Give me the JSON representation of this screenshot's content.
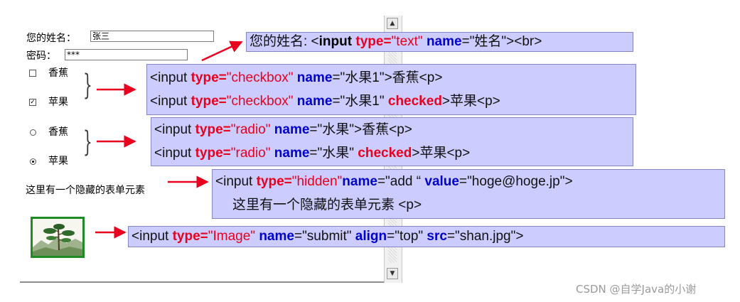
{
  "form": {
    "name_label": "您的姓名：",
    "name_value": "张三",
    "password_label": "密码：",
    "password_value": "***",
    "checkbox_items": [
      {
        "label": "香蕉",
        "checked": false
      },
      {
        "label": "苹果",
        "checked": true
      }
    ],
    "radio_items": [
      {
        "label": "香蕉",
        "checked": false
      },
      {
        "label": "苹果",
        "checked": true
      }
    ],
    "hidden_text": "这里有一个隐藏的表单元素",
    "check_mark": "✓"
  },
  "scrollbar": {
    "up_arrow": "▲",
    "down_arrow": "▼"
  },
  "annotations": {
    "text_input": {
      "t1": "您的姓名: <",
      "tag": "input",
      "attr_type": "type=",
      "val_type": "\"text\"",
      "attr_name": "name",
      "name_val": "=\"姓名\"><br>"
    },
    "checkbox": {
      "line1": {
        "open": "<input ",
        "attr_type": "type=",
        "val_type": "\"checkbox\"",
        "attr_name": " name",
        "rest": "=\"水果1\">香蕉<p>"
      },
      "line2": {
        "open": "<input ",
        "attr_type": "type=",
        "val_type": "\"checkbox\"",
        "attr_name": " name",
        "mid": "=\"水果1\" ",
        "checked": "checked",
        "rest": ">苹果<p>"
      }
    },
    "radio": {
      "line1": {
        "open": "<input ",
        "attr_type": "type=",
        "val_type": "\"radio\"",
        "attr_name": " name",
        "rest": "=\"水果\">香蕉<p>"
      },
      "line2": {
        "open": "<input ",
        "attr_type": "type=",
        "val_type": "\"radio\"",
        "attr_name": " name",
        "mid": "=\"水果\" ",
        "checked": "checked",
        "rest": ">苹果<p>"
      }
    },
    "hidden": {
      "line1": {
        "open": "<input ",
        "attr_type": "type=",
        "val_type": "\"hidden\"",
        "attr_name": "name",
        "mid": "=\"add “ ",
        "attr_value": "value",
        "rest": "=\"hoge@hoge.jp\">"
      },
      "line2": "这里有一个隐藏的表单元素 <p>"
    },
    "image": {
      "open": "<input ",
      "attr_type": "type=",
      "val_type": "\"Image\"",
      "attr_name": " name",
      "mid1": "=\"submit\" ",
      "attr_align": "align",
      "mid2": "=\"top\" ",
      "attr_src": "src",
      "rest": "=\"shan.jpg\">"
    }
  },
  "watermark": "CSDN @自学Java的小谢",
  "colors": {
    "annotation_bg": "#ccccff",
    "keyword_blue": "#0000cc",
    "keyword_red": "#e8001f",
    "arrow_red": "#e8001f",
    "image_border_green": "#1d8c25"
  }
}
